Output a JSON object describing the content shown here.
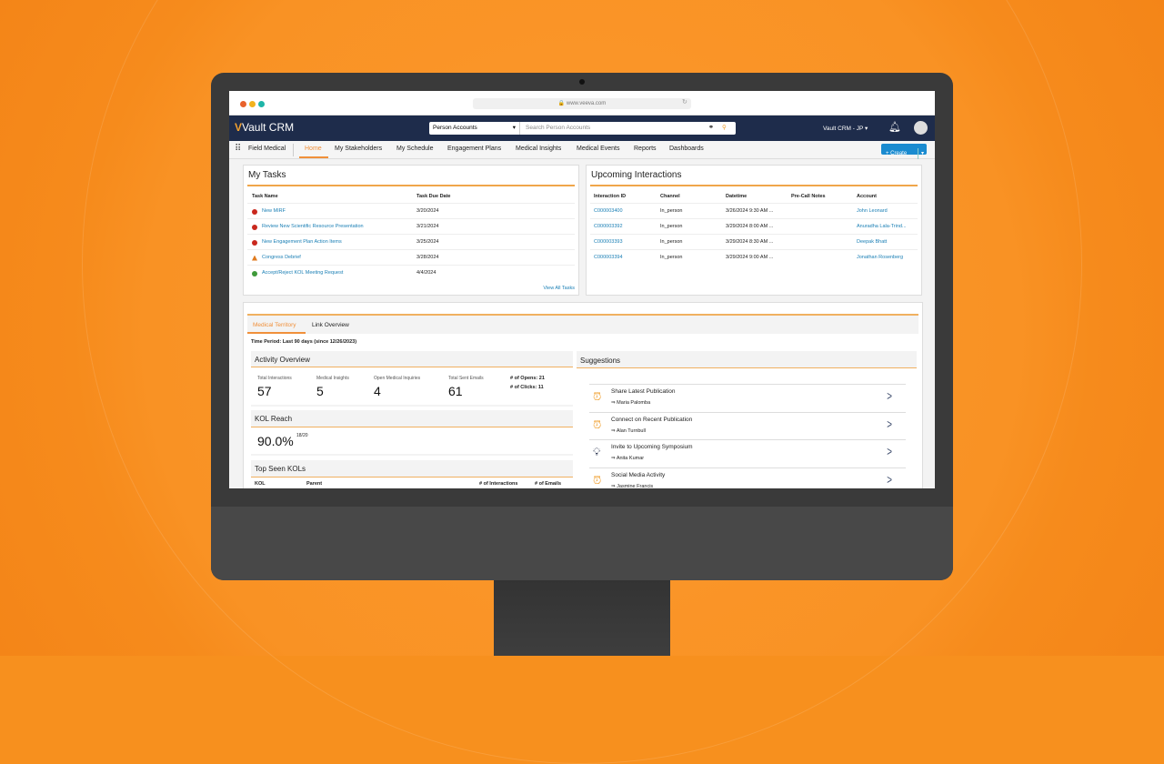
{
  "browser": {
    "url": "www.veeva.com"
  },
  "header": {
    "brand_mark": "V",
    "brand": "Vault CRM",
    "search_scope": "Person Accounts",
    "search_placeholder": "Search Person Accounts",
    "org": "Vault CRM - JP ▾"
  },
  "nav": {
    "app": "Field Medical",
    "tabs": [
      "Home",
      "My Stakeholders",
      "My Schedule",
      "Engagement Plans",
      "Medical Insights",
      "Medical Events",
      "Reports",
      "Dashboards"
    ],
    "create": "+ Create"
  },
  "tasks": {
    "title": "My Tasks",
    "headers": [
      "Task Name",
      "Task Due Date"
    ],
    "rows": [
      {
        "name": "New MIRF",
        "date": "3/20/2024",
        "status": "overdue"
      },
      {
        "name": "Review New Scientific Resource Presentation",
        "date": "3/21/2024",
        "status": "overdue"
      },
      {
        "name": "New Engagement Plan Action Items",
        "date": "3/25/2024",
        "status": "overdue"
      },
      {
        "name": "Congress Debrief",
        "date": "3/28/2024",
        "status": "warning"
      },
      {
        "name": "Accept/Reject KOL Meeting Request",
        "date": "4/4/2024",
        "status": "ok"
      }
    ],
    "view_all": "View All Tasks"
  },
  "interactions": {
    "title": "Upcoming Interactions",
    "headers": [
      "Interaction ID",
      "Channel",
      "Datetime",
      "Pre-Call Notes",
      "Account"
    ],
    "rows": [
      [
        "C000003400",
        "In_person",
        "3/26/2024 9:30 AM ...",
        "",
        "John Leonard"
      ],
      [
        "C000003392",
        "In_person",
        "3/29/2024 8:00 AM ...",
        "",
        "Anuradha Lala-Trind..."
      ],
      [
        "C000003393",
        "In_person",
        "3/29/2024 8:30 AM ...",
        "",
        "Deepak Bhatt"
      ],
      [
        "C000003394",
        "In_person",
        "3/29/2024 9:00 AM ...",
        "",
        "Jonathan Rosenberg"
      ]
    ]
  },
  "territory": {
    "tabs": [
      "Medical Territory",
      "Link Overview"
    ],
    "period": "Time Period: Last 90 days (since 12/26/2023)",
    "activity": {
      "title": "Activity Overview",
      "metrics": [
        {
          "label": "Total Interactions",
          "value": "57"
        },
        {
          "label": "Medical Insights",
          "value": "5"
        },
        {
          "label": "Open Medical Inquiries",
          "value": "4"
        },
        {
          "label": "Total Sent Emails",
          "value": "61"
        }
      ],
      "opens": "# of Opens: 21",
      "clicks": "# of Clicks: 11"
    },
    "kol": {
      "title": "KOL Reach",
      "value": "90.0%",
      "fraction": "18/20"
    },
    "top": {
      "title": "Top Seen KOLs",
      "headers": [
        "KOL",
        "Parent",
        "# of Interactions",
        "# of Emails"
      ]
    }
  },
  "suggestions": {
    "title": "Suggestions",
    "items": [
      {
        "title": "Share Latest Publication",
        "person": "⇒ Maria Palomba",
        "icon": "alarm"
      },
      {
        "title": "Connect on Recent Publication",
        "person": "⇒ Alan Turnbull",
        "icon": "alarm"
      },
      {
        "title": "Invite to Upcoming Symposium",
        "person": "⇒ Anita Kumar",
        "icon": "lightbulb"
      },
      {
        "title": "Social Media Activity",
        "person": "⇒ Jasmine Francis",
        "icon": "alarm"
      }
    ]
  }
}
